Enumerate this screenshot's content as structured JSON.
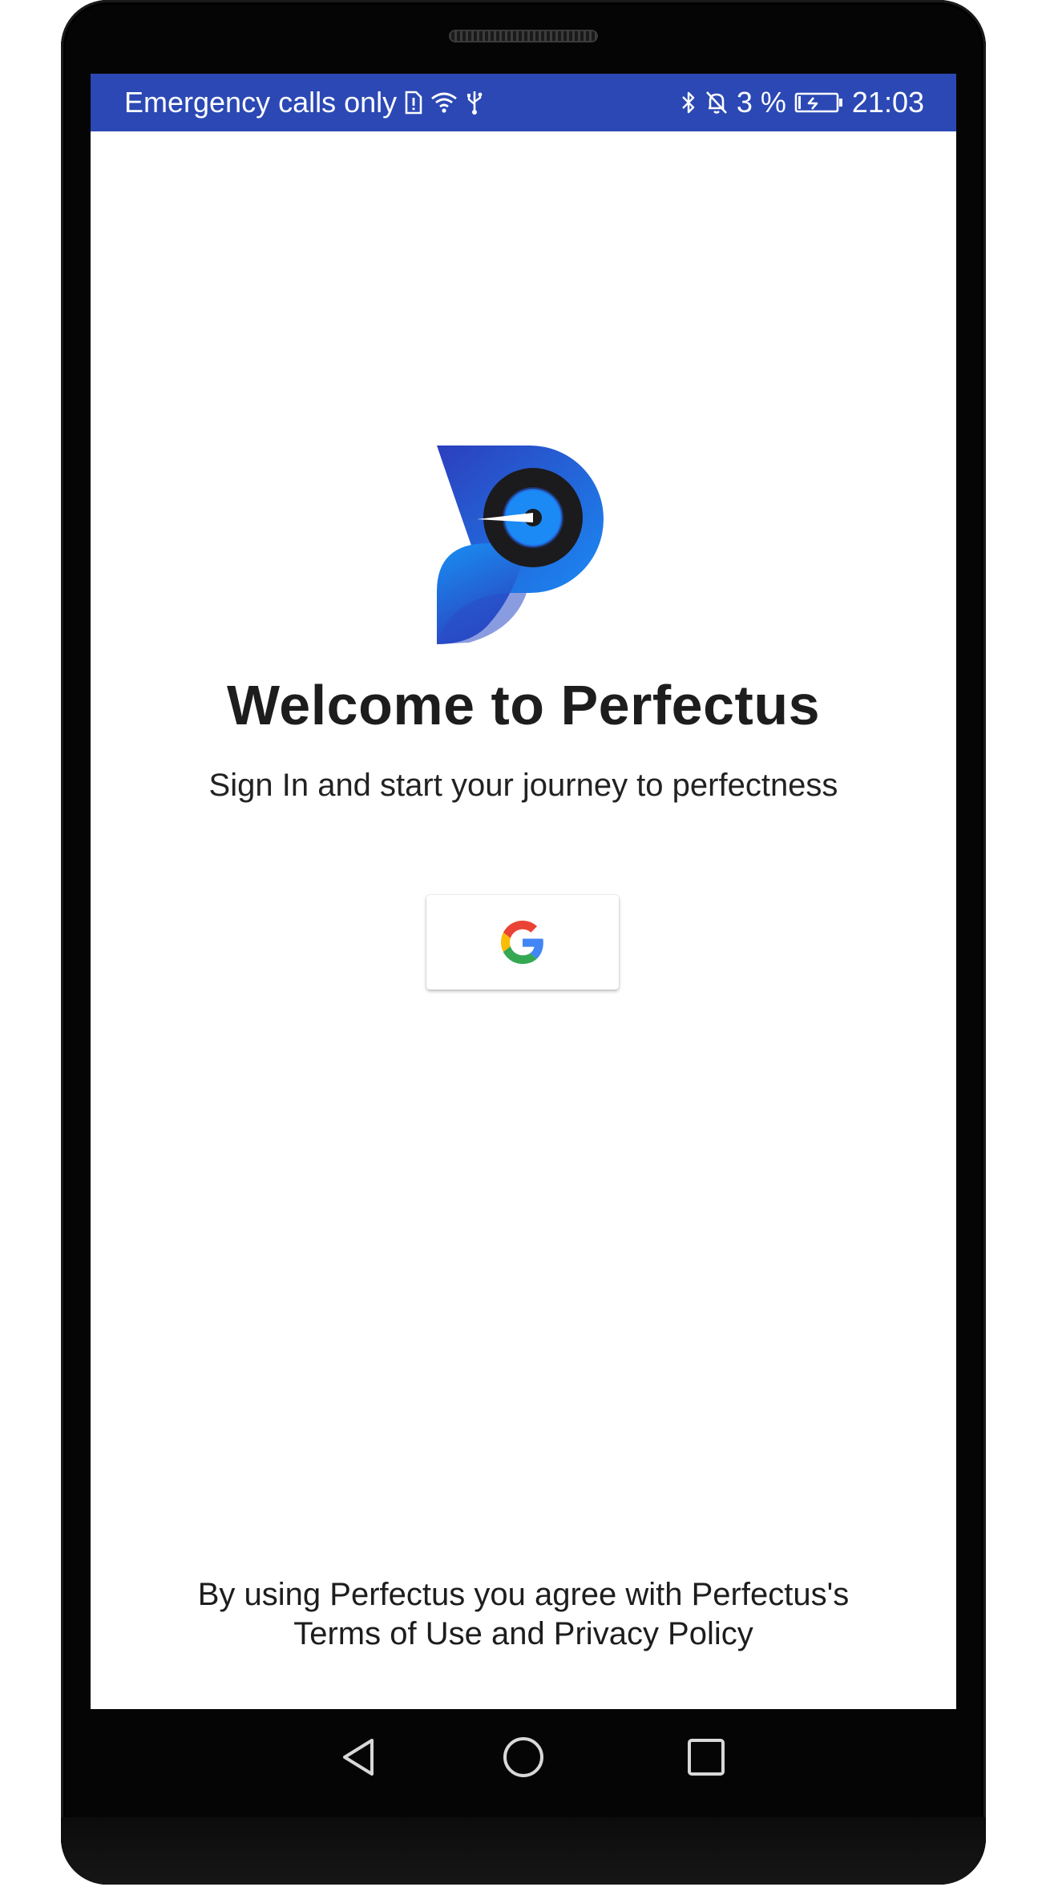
{
  "status_bar": {
    "carrier_text": "Emergency calls only",
    "battery_percent": "3 %",
    "time": "21:03",
    "icons_left": [
      "sim-alert-icon",
      "wifi-icon",
      "usb-icon"
    ],
    "icons_right": [
      "bluetooth-icon",
      "notifications-off-icon",
      "battery-charging-icon"
    ],
    "color": "#2b48b4"
  },
  "welcome": {
    "title": "Welcome to Perfectus",
    "subtitle": "Sign In and start your journey to perfectness"
  },
  "sign_in": {
    "button_icon": "google-g-icon"
  },
  "footer": {
    "line1": "By using Perfectus you agree with Perfectus's",
    "line2": "Terms of Use and Privacy Policy"
  },
  "nav_bar": {
    "buttons": [
      "back-icon",
      "home-icon",
      "recents-icon"
    ]
  },
  "colors": {
    "brand_blue_dark": "#2b3fb8",
    "brand_blue_light": "#1a8cf5",
    "text": "#1d1d1d"
  }
}
